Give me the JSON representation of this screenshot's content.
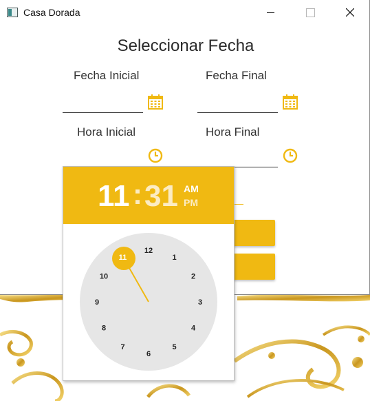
{
  "window": {
    "title": "Casa Dorada"
  },
  "heading": "Seleccionar Fecha",
  "labels": {
    "fecha_inicial": "Fecha Inicial",
    "fecha_final": "Fecha Final",
    "hora_inicial": "Hora Inicial",
    "hora_final": "Hora Final"
  },
  "clock": {
    "hour": "11",
    "separator": ":",
    "minute": "31",
    "am": "AM",
    "pm": "PM",
    "selected_hour": "11",
    "numbers": [
      "12",
      "1",
      "2",
      "3",
      "4",
      "5",
      "6",
      "7",
      "8",
      "9",
      "10",
      "11"
    ]
  },
  "icons": {
    "calendar": "calendar-icon",
    "clock": "clock-icon"
  },
  "colors": {
    "accent": "#f0b912",
    "dial": "#e6e6e6"
  }
}
